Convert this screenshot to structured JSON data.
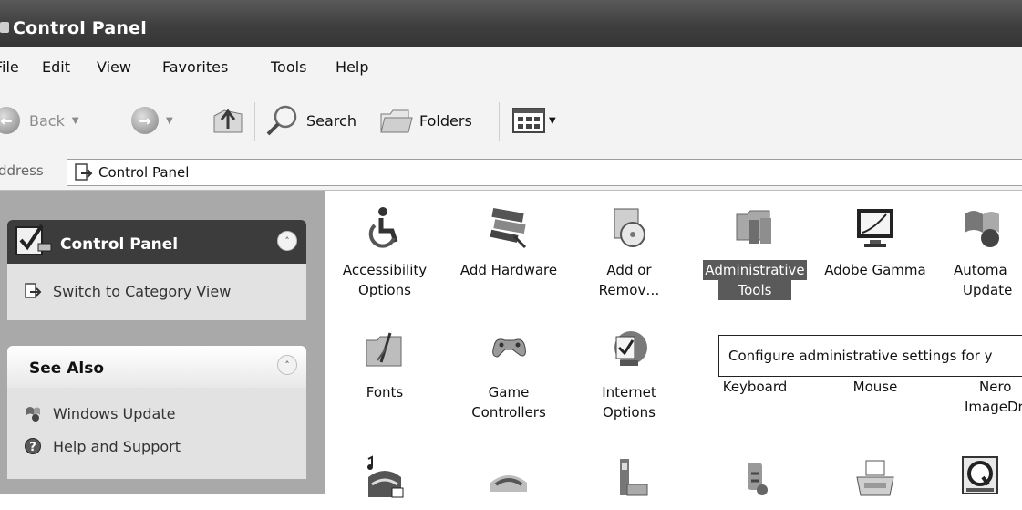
{
  "window": {
    "title": "Control Panel"
  },
  "menu": [
    "File",
    "Edit",
    "View",
    "Favorites",
    "Tools",
    "Help"
  ],
  "toolbar": {
    "back_label": "Back",
    "search_label": "Search",
    "folders_label": "Folders"
  },
  "address": {
    "label": "Address",
    "value": "Control Panel"
  },
  "left_panel": {
    "control_panel_box": {
      "title": "Control Panel",
      "link": "Switch to Category View"
    },
    "see_also_box": {
      "title": "See Also",
      "links": [
        "Windows Update",
        "Help and Support"
      ]
    }
  },
  "items": [
    {
      "label_line1": "Accessibility",
      "label_line2": "Options",
      "icon": "accessibility-icon"
    },
    {
      "label_line1": "Add Hardware",
      "label_line2": "",
      "icon": "add-hardware-icon"
    },
    {
      "label_line1": "Add or",
      "label_line2": "Remov…",
      "icon": "add-remove-programs-icon"
    },
    {
      "label_line1": "Administrative",
      "label_line2": "Tools",
      "icon": "administrative-tools-icon",
      "selected": true
    },
    {
      "label_line1": "Adobe Gamma",
      "label_line2": "",
      "icon": "adobe-gamma-icon"
    },
    {
      "label_line1": "Automa",
      "label_line2": "Update",
      "icon": "automatic-updates-icon"
    },
    {
      "label_line1": "Fonts",
      "label_line2": "",
      "icon": "fonts-icon"
    },
    {
      "label_line1": "Game",
      "label_line2": "Controllers",
      "icon": "game-controllers-icon"
    },
    {
      "label_line1": "Internet",
      "label_line2": "Options",
      "icon": "internet-options-icon"
    },
    {
      "label_line1": "Keyboard",
      "label_line2": "",
      "icon": "keyboard-icon"
    },
    {
      "label_line1": "Mouse",
      "label_line2": "",
      "icon": "mouse-icon"
    },
    {
      "label_line1": "Nero",
      "label_line2": "ImageDr",
      "icon": "nero-imagedrive-icon"
    }
  ],
  "tooltip": "Configure administrative settings for y"
}
